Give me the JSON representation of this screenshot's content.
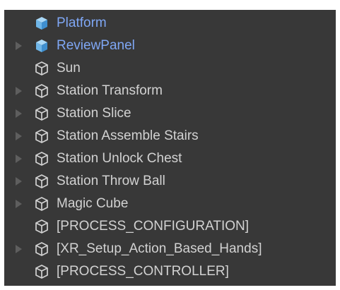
{
  "colors": {
    "background": "#383838",
    "text": "#d2d2d2",
    "prefab_text": "#7fa7f5",
    "prefab_icon": "#6fb6e8",
    "foldout_arrow": "#5e5e5e"
  },
  "hierarchy": {
    "items": [
      {
        "label": "Platform",
        "icon": "prefab-icon",
        "prefab": true,
        "expandable": false
      },
      {
        "label": "ReviewPanel",
        "icon": "prefab-icon",
        "prefab": true,
        "expandable": true
      },
      {
        "label": "Sun",
        "icon": "gameobject-icon",
        "prefab": false,
        "expandable": false
      },
      {
        "label": "Station Transform",
        "icon": "gameobject-icon",
        "prefab": false,
        "expandable": true
      },
      {
        "label": "Station Slice",
        "icon": "gameobject-icon",
        "prefab": false,
        "expandable": true
      },
      {
        "label": "Station Assemble Stairs",
        "icon": "gameobject-icon",
        "prefab": false,
        "expandable": true
      },
      {
        "label": "Station Unlock Chest",
        "icon": "gameobject-icon",
        "prefab": false,
        "expandable": true
      },
      {
        "label": "Station Throw Ball",
        "icon": "gameobject-icon",
        "prefab": false,
        "expandable": true
      },
      {
        "label": "Magic Cube",
        "icon": "gameobject-icon",
        "prefab": false,
        "expandable": true
      },
      {
        "label": "[PROCESS_CONFIGURATION]",
        "icon": "gameobject-icon",
        "prefab": false,
        "expandable": false
      },
      {
        "label": "[XR_Setup_Action_Based_Hands]",
        "icon": "gameobject-icon",
        "prefab": false,
        "expandable": true
      },
      {
        "label": "[PROCESS_CONTROLLER]",
        "icon": "gameobject-icon",
        "prefab": false,
        "expandable": false
      }
    ]
  }
}
